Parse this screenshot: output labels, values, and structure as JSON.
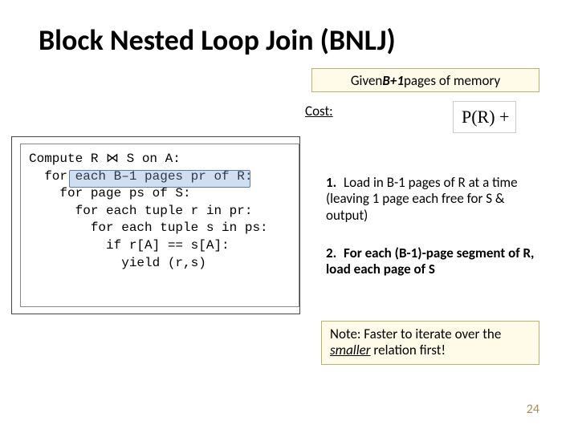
{
  "title": "Block Nested Loop Join (BNLJ)",
  "given": {
    "pre": "Given ",
    "mid": "B+1",
    "post": " pages of memory"
  },
  "cost_label": "Cost:",
  "formula": "P(R) +  ",
  "code": {
    "l1a": "Compute ",
    "l1b": "R ⋈ S on A:",
    "l2": "  for each B–1 pages pr of R:",
    "l3": "    for page ps of S:",
    "l4": "      for each tuple r in pr:",
    "l5": "        for each tuple s in ps:",
    "l6": "          if r[A] == s[A]:",
    "l7": "            yield (r,s)"
  },
  "steps": {
    "s1n": "1.",
    "s1": "Load in B-1 pages of R at a time (leaving 1 page each free for S & output)",
    "s2n": "2.",
    "s2": "For each (B-1)-page segment of R, load each page of S"
  },
  "note": {
    "line1": "Note: Faster to iterate over the ",
    "emph": "smaller",
    "line2": " relation first!"
  },
  "pagenum": "24"
}
